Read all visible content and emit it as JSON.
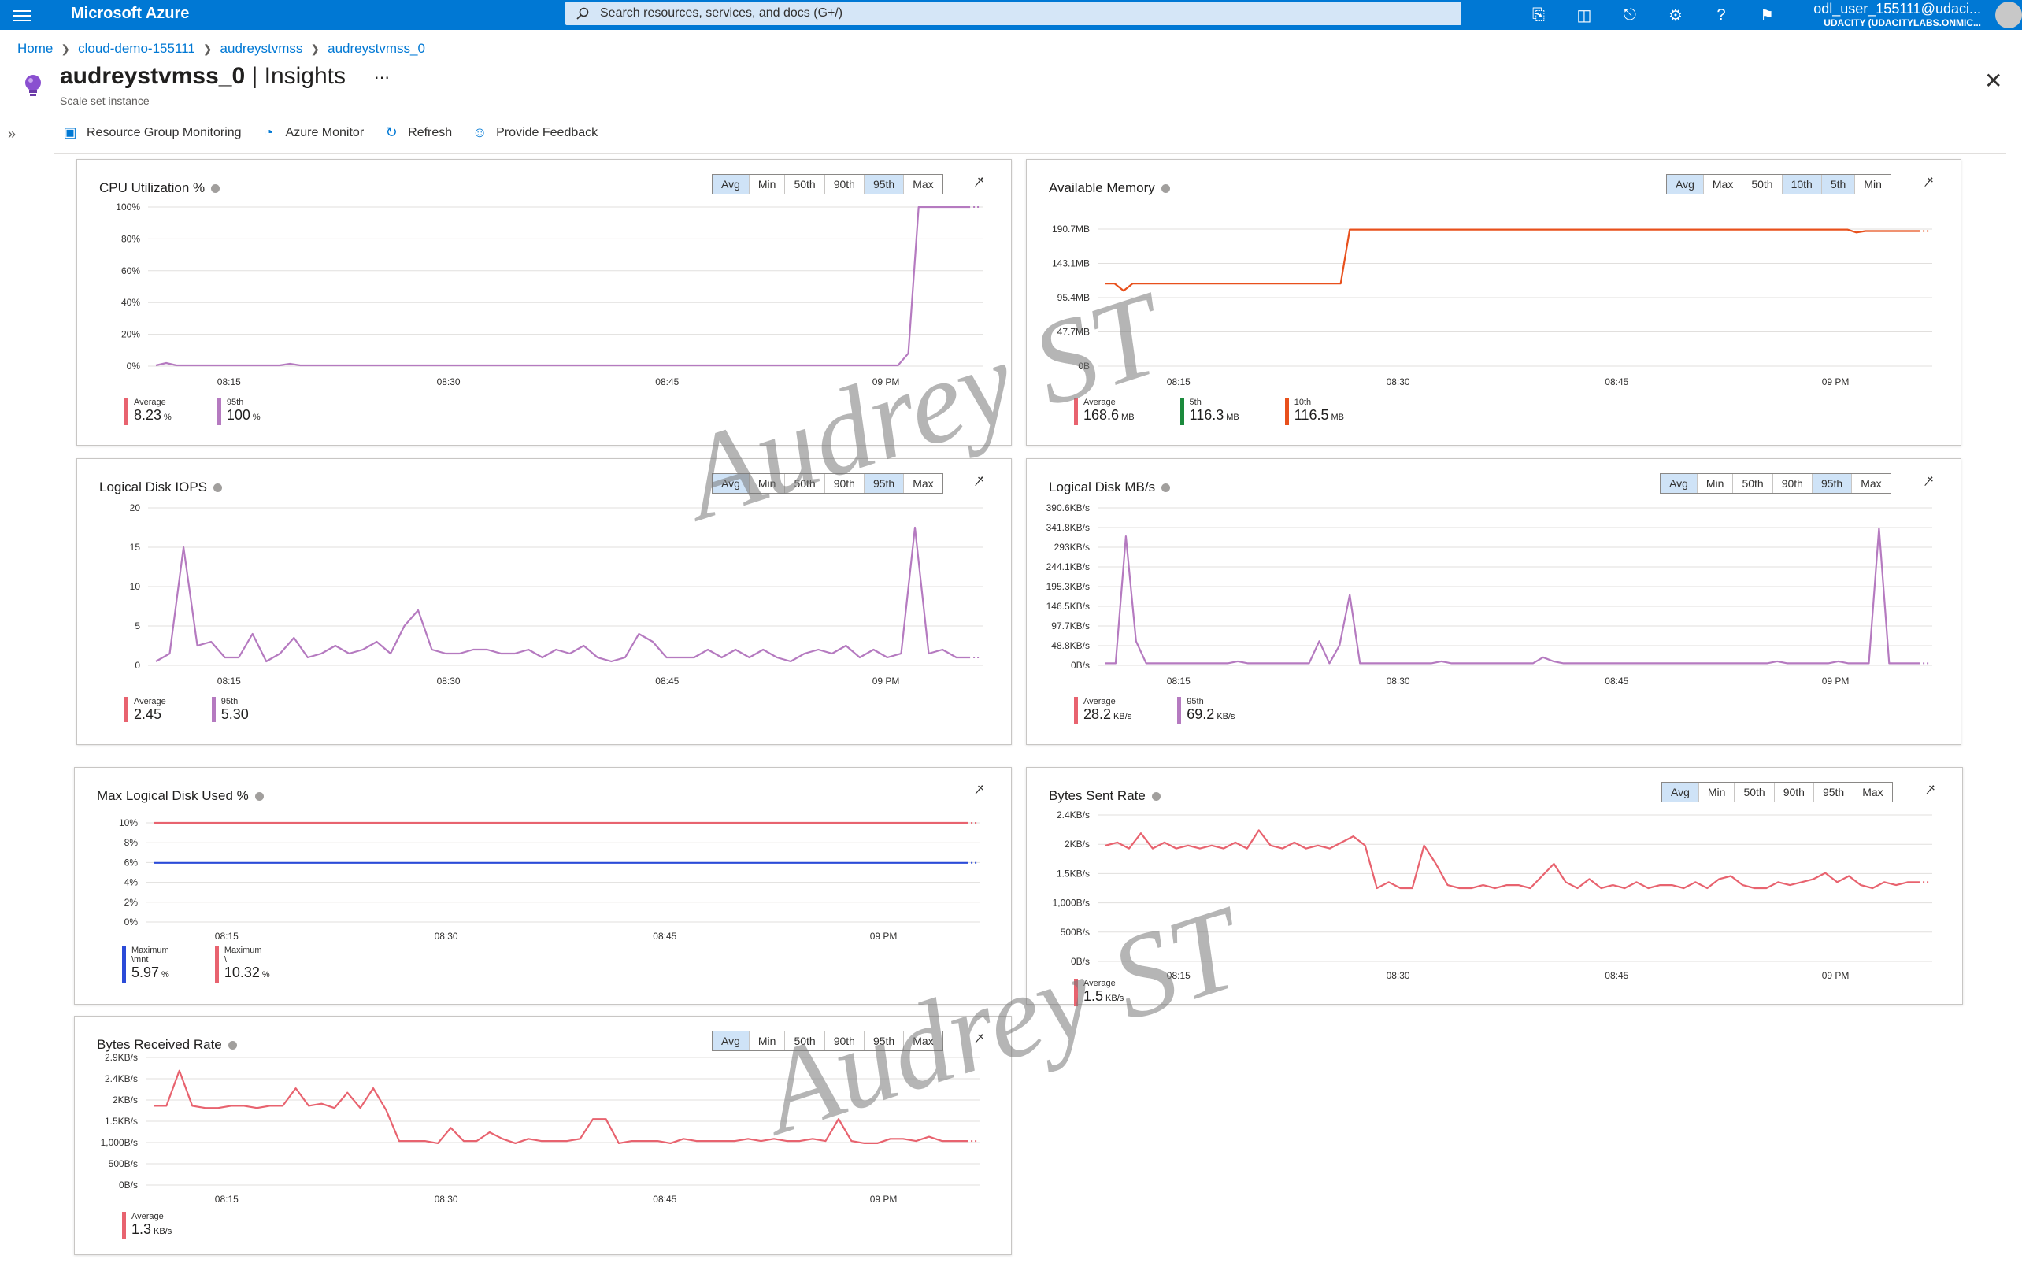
{
  "topbar": {
    "brand": "Microsoft Azure",
    "search_placeholder": "Search resources, services, and docs (G+/)",
    "user_name": "odl_user_155111@udaci...",
    "user_tenant": "UDACITY (UDACITYLABS.ONMIC..."
  },
  "breadcrumb": [
    "Home",
    "cloud-demo-155111",
    "audreystvmss",
    "audreystvmss_0"
  ],
  "page": {
    "title_main": "audreystvmss_0",
    "title_sep": " | Insights",
    "subtitle": "Scale set instance"
  },
  "commands": [
    {
      "label": "Resource Group Monitoring",
      "icon": "monitor-icon"
    },
    {
      "label": "Azure Monitor",
      "icon": "gauge-icon"
    },
    {
      "label": "Refresh",
      "icon": "refresh-icon"
    },
    {
      "label": "Provide Feedback",
      "icon": "smile-icon"
    }
  ],
  "watermark": "Audrey ST",
  "x_ticks": [
    "08:15",
    "08:30",
    "08:45",
    "09 PM"
  ],
  "panels": [
    {
      "key": "cpu",
      "title": "CPU Utilization %",
      "pills": [
        "Avg",
        "Min",
        "50th",
        "90th",
        "95th",
        "Max"
      ],
      "active": [
        "Avg",
        "95th"
      ],
      "legend": [
        {
          "label": "Average",
          "value": "8.23",
          "unit": "%",
          "color": "#e8636f"
        },
        {
          "label": "95th",
          "value": "100",
          "unit": "%",
          "color": "#b57ac0"
        }
      ]
    },
    {
      "key": "mem",
      "title": "Available Memory",
      "pills": [
        "Avg",
        "Max",
        "50th",
        "10th",
        "5th",
        "Min"
      ],
      "active": [
        "Avg",
        "10th",
        "5th"
      ],
      "legend": [
        {
          "label": "Average",
          "value": "168.6",
          "unit": "MB",
          "color": "#e8636f"
        },
        {
          "label": "5th",
          "value": "116.3",
          "unit": "MB",
          "color": "#1b8a3c"
        },
        {
          "label": "10th",
          "value": "116.5",
          "unit": "MB",
          "color": "#e8501c"
        }
      ]
    },
    {
      "key": "iops",
      "title": "Logical Disk IOPS",
      "pills": [
        "Avg",
        "Min",
        "50th",
        "90th",
        "95th",
        "Max"
      ],
      "active": [
        "Avg",
        "95th"
      ],
      "legend": [
        {
          "label": "Average",
          "value": "2.45",
          "unit": "",
          "color": "#e8636f"
        },
        {
          "label": "95th",
          "value": "5.30",
          "unit": "",
          "color": "#b57ac0"
        }
      ]
    },
    {
      "key": "mbs",
      "title": "Logical Disk MB/s",
      "pills": [
        "Avg",
        "Min",
        "50th",
        "90th",
        "95th",
        "Max"
      ],
      "active": [
        "Avg",
        "95th"
      ],
      "legend": [
        {
          "label": "Average",
          "value": "28.2",
          "unit": "KB/s",
          "color": "#e8636f"
        },
        {
          "label": "95th",
          "value": "69.2",
          "unit": "KB/s",
          "color": "#b57ac0"
        }
      ]
    },
    {
      "key": "disk",
      "title": "Max Logical Disk Used %",
      "pills": [],
      "active": [],
      "legend": [
        {
          "label": "Maximum",
          "label2": "\\mnt",
          "value": "5.97",
          "unit": "%",
          "color": "#2b4bd8"
        },
        {
          "label": "Maximum",
          "label2": "\\",
          "value": "10.32",
          "unit": "%",
          "color": "#e8636f"
        }
      ]
    },
    {
      "key": "sent",
      "title": "Bytes Sent Rate",
      "pills": [
        "Avg",
        "Min",
        "50th",
        "90th",
        "95th",
        "Max"
      ],
      "active": [
        "Avg"
      ],
      "legend": [
        {
          "label": "Average",
          "value": "1.5",
          "unit": "KB/s",
          "color": "#e8636f"
        }
      ]
    },
    {
      "key": "recv",
      "title": "Bytes Received Rate",
      "pills": [
        "Avg",
        "Min",
        "50th",
        "90th",
        "95th",
        "Max"
      ],
      "active": [
        "Avg"
      ],
      "legend": [
        {
          "label": "Average",
          "value": "1.3",
          "unit": "KB/s",
          "color": "#e8636f"
        }
      ]
    }
  ],
  "chart_data": [
    {
      "type": "line",
      "panel": "cpu",
      "y_ticks": [
        "100%",
        "80%",
        "60%",
        "40%",
        "20%",
        "0%"
      ],
      "ylim": [
        0,
        100
      ],
      "series": [
        {
          "color": "#b57ac0",
          "values": [
            0.5,
            2,
            0.5,
            0.5,
            0.5,
            0.5,
            0.5,
            0.5,
            0.5,
            0.5,
            0.5,
            0.5,
            0.5,
            1.5,
            0.5,
            0.5,
            0.5,
            0.5,
            0.5,
            0.5,
            0.5,
            0.5,
            0.5,
            0.5,
            0.5,
            0.5,
            0.5,
            0.5,
            0.5,
            0.5,
            0.5,
            0.5,
            0.5,
            0.5,
            0.5,
            0.5,
            0.5,
            0.5,
            0.5,
            0.5,
            0.5,
            0.5,
            0.5,
            0.5,
            0.5,
            0.5,
            0.5,
            0.5,
            0.5,
            0.5,
            0.5,
            0.5,
            0.5,
            0.5,
            0.5,
            0.5,
            0.5,
            0.5,
            0.5,
            0.5,
            0.5,
            0.5,
            0.5,
            0.5,
            0.5,
            0.5,
            0.5,
            0.5,
            0.5,
            0.5,
            0.5,
            0.5,
            0.5,
            8,
            100,
            100,
            100,
            100,
            100,
            100
          ]
        }
      ]
    },
    {
      "type": "line",
      "panel": "mem",
      "y_ticks": [
        "190.7MB",
        "143.1MB",
        "95.4MB",
        "47.7MB",
        "0B"
      ],
      "ylim": [
        0,
        190.7
      ],
      "series": [
        {
          "color": "#e8501c",
          "values": [
            115,
            115,
            105,
            115,
            115,
            115,
            115,
            115,
            115,
            115,
            115,
            115,
            115,
            115,
            115,
            115,
            115,
            115,
            115,
            115,
            115,
            115,
            115,
            115,
            115,
            115,
            115,
            190,
            190,
            190,
            190,
            190,
            190,
            190,
            190,
            190,
            190,
            190,
            190,
            190,
            190,
            190,
            190,
            190,
            190,
            190,
            190,
            190,
            190,
            190,
            190,
            190,
            190,
            190,
            190,
            190,
            190,
            190,
            190,
            190,
            190,
            190,
            190,
            190,
            190,
            190,
            190,
            190,
            190,
            190,
            190,
            190,
            190,
            190,
            190,
            190,
            190,
            190,
            190,
            190,
            190,
            190,
            190,
            186,
            188,
            188,
            188,
            188,
            188,
            188,
            188
          ]
        }
      ]
    },
    {
      "type": "line",
      "panel": "iops",
      "y_ticks": [
        "20",
        "15",
        "10",
        "5",
        "0"
      ],
      "ylim": [
        0,
        20
      ],
      "series": [
        {
          "color": "#b57ac0",
          "values": [
            0.5,
            1.5,
            15,
            2.5,
            3,
            1,
            1,
            4,
            0.5,
            1.5,
            3.5,
            1,
            1.5,
            2.5,
            1.5,
            2,
            3,
            1.5,
            5,
            7,
            2,
            1.5,
            1.5,
            2,
            2,
            1.5,
            1.5,
            2,
            1,
            2,
            1.5,
            2.5,
            1,
            0.5,
            1,
            4,
            3,
            1,
            1,
            1,
            2,
            1,
            2,
            1,
            2,
            1,
            0.5,
            1.5,
            2,
            1.5,
            2.5,
            1,
            2,
            1,
            1.5,
            17.5,
            1.5,
            2,
            1,
            1
          ]
        }
      ]
    },
    {
      "type": "line",
      "panel": "mbs",
      "y_ticks": [
        "390.6KB/s",
        "341.8KB/s",
        "293KB/s",
        "244.1KB/s",
        "195.3KB/s",
        "146.5KB/s",
        "97.7KB/s",
        "48.8KB/s",
        "0B/s"
      ],
      "ylim": [
        0,
        390.6
      ],
      "series": [
        {
          "color": "#b57ac0",
          "values": [
            5,
            5,
            320,
            60,
            5,
            5,
            5,
            5,
            5,
            5,
            5,
            5,
            5,
            10,
            5,
            5,
            5,
            5,
            5,
            5,
            5,
            60,
            5,
            50,
            175,
            5,
            5,
            5,
            5,
            5,
            5,
            5,
            5,
            10,
            5,
            5,
            5,
            5,
            5,
            5,
            5,
            5,
            5,
            20,
            10,
            5,
            5,
            5,
            5,
            5,
            5,
            5,
            5,
            5,
            5,
            5,
            5,
            5,
            5,
            5,
            5,
            5,
            5,
            5,
            5,
            5,
            10,
            5,
            5,
            5,
            5,
            5,
            10,
            5,
            5,
            5,
            340,
            5,
            5,
            5,
            5
          ]
        }
      ]
    },
    {
      "type": "line",
      "panel": "disk",
      "y_ticks": [
        "10%",
        "8%",
        "6%",
        "4%",
        "2%",
        "0%"
      ],
      "ylim": [
        0,
        10
      ],
      "series": [
        {
          "name": "\\",
          "color": "#e8636f",
          "values": [
            10.32,
            10.32
          ]
        },
        {
          "name": "\\mnt",
          "color": "#2b4bd8",
          "values": [
            5.97,
            5.97
          ]
        }
      ]
    },
    {
      "type": "line",
      "panel": "sent",
      "y_ticks": [
        "2.4KB/s",
        "2KB/s",
        "1.5KB/s",
        "1,000B/s",
        "500B/s",
        "0B/s"
      ],
      "ylim": [
        0,
        2.4
      ],
      "series": [
        {
          "color": "#e8636f",
          "values": [
            1.9,
            1.95,
            1.85,
            2.1,
            1.85,
            1.95,
            1.85,
            1.9,
            1.85,
            1.9,
            1.85,
            1.95,
            1.85,
            2.15,
            1.9,
            1.85,
            1.95,
            1.85,
            1.9,
            1.85,
            1.95,
            2.05,
            1.9,
            1.2,
            1.3,
            1.2,
            1.2,
            1.9,
            1.6,
            1.25,
            1.2,
            1.2,
            1.25,
            1.2,
            1.25,
            1.25,
            1.2,
            1.4,
            1.6,
            1.3,
            1.2,
            1.35,
            1.2,
            1.25,
            1.2,
            1.3,
            1.2,
            1.25,
            1.25,
            1.2,
            1.3,
            1.2,
            1.35,
            1.4,
            1.25,
            1.2,
            1.2,
            1.3,
            1.25,
            1.3,
            1.35,
            1.45,
            1.3,
            1.4,
            1.25,
            1.2,
            1.3,
            1.25,
            1.3,
            1.3
          ]
        }
      ]
    },
    {
      "type": "line",
      "panel": "recv",
      "y_ticks": [
        "2.9KB/s",
        "2.4KB/s",
        "2KB/s",
        "1.5KB/s",
        "1,000B/s",
        "500B/s",
        "0B/s"
      ],
      "ylim": [
        0,
        2.9
      ],
      "series": [
        {
          "color": "#e8636f",
          "values": [
            1.8,
            1.8,
            2.6,
            1.8,
            1.75,
            1.75,
            1.8,
            1.8,
            1.75,
            1.8,
            1.8,
            2.2,
            1.8,
            1.85,
            1.75,
            2.1,
            1.75,
            2.2,
            1.7,
            1,
            1,
            1,
            0.95,
            1.3,
            1,
            1,
            1.2,
            1.05,
            0.95,
            1.05,
            1,
            1,
            1,
            1.05,
            1.5,
            1.5,
            0.95,
            1,
            1,
            1,
            0.95,
            1.05,
            1,
            1,
            1,
            1,
            1.05,
            1,
            1.05,
            1,
            1,
            1.05,
            1,
            1.5,
            1,
            0.95,
            0.95,
            1.05,
            1.05,
            1,
            1.1,
            1,
            1,
            1
          ]
        }
      ]
    }
  ]
}
